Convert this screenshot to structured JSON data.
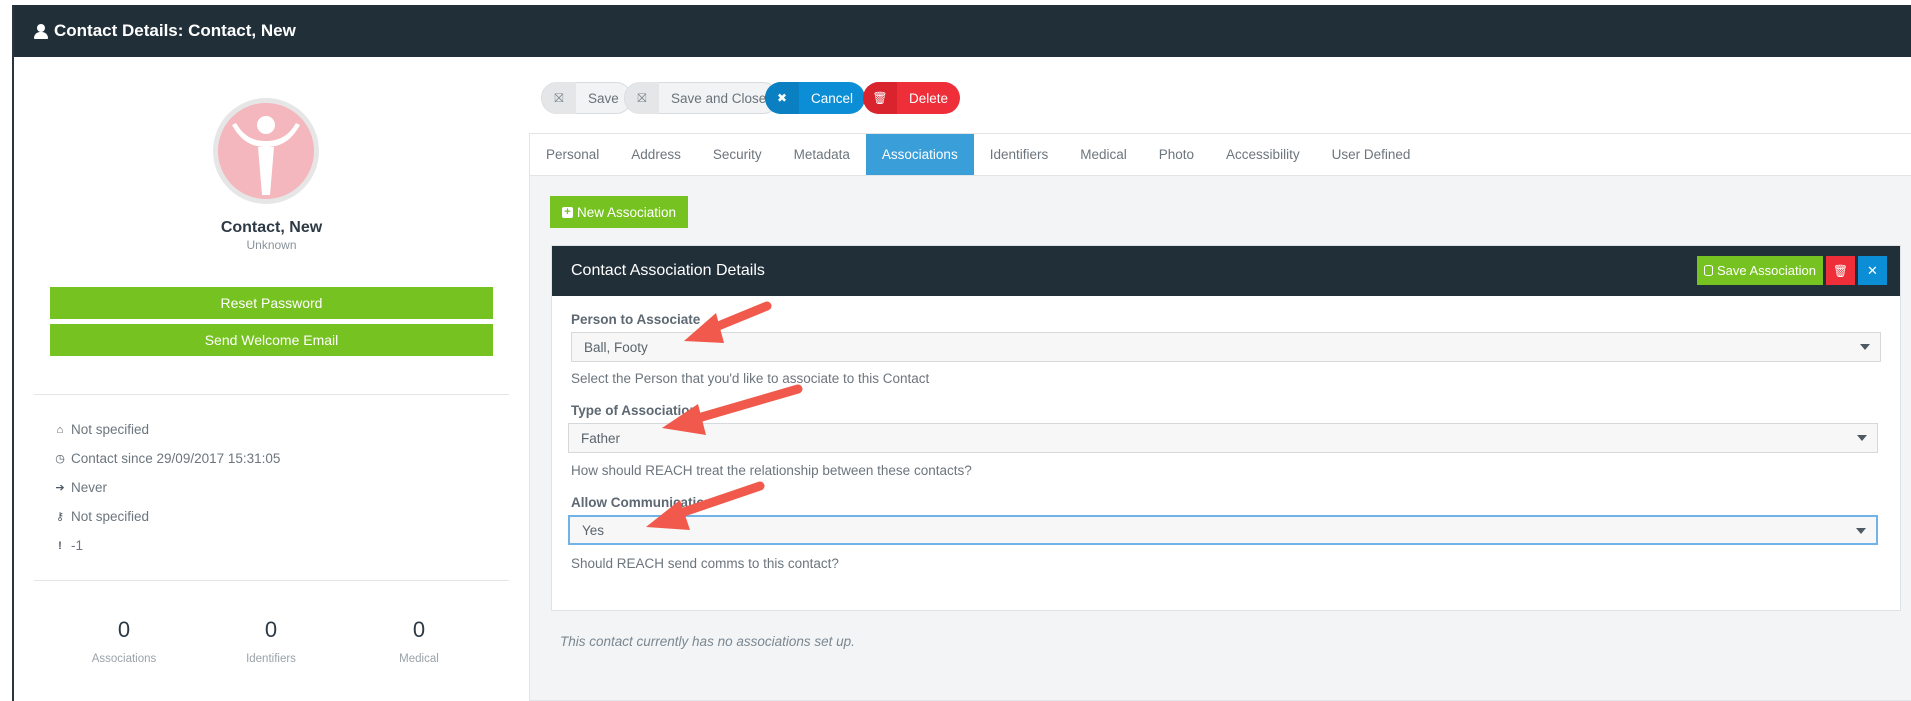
{
  "window": {
    "title": "Contact Details: Contact, New"
  },
  "profile": {
    "name": "Contact, New",
    "subtitle": "Unknown",
    "reset_password_label": "Reset Password",
    "send_welcome_label": "Send Welcome Email",
    "info": [
      {
        "icon": "home-icon",
        "text": "Not specified"
      },
      {
        "icon": "clock-icon",
        "text": "Contact since 29/09/2017 15:31:05"
      },
      {
        "icon": "sign-in-icon",
        "text": "Never"
      },
      {
        "icon": "key-icon",
        "text": "Not specified"
      },
      {
        "icon": "exclamation-icon",
        "text": "-1"
      }
    ],
    "stats": [
      {
        "value": "0",
        "label": "Associations"
      },
      {
        "value": "0",
        "label": "Identifiers"
      },
      {
        "value": "0",
        "label": "Medical"
      }
    ]
  },
  "toolbar": {
    "save_label": "Save",
    "save_close_label": "Save and Close",
    "cancel_label": "Cancel",
    "delete_label": "Delete"
  },
  "tabs": [
    "Personal",
    "Address",
    "Security",
    "Metadata",
    "Associations",
    "Identifiers",
    "Medical",
    "Photo",
    "Accessibility",
    "User Defined"
  ],
  "active_tab": "Associations",
  "associations": {
    "new_label": "New Association",
    "card_title": "Contact Association Details",
    "save_assoc_label": "Save Association",
    "person_label": "Person to Associate",
    "person_value": "Ball, Footy",
    "person_help": "Select the Person that you'd like to associate to this Contact",
    "type_label": "Type of Association",
    "type_value": "Father",
    "type_help": "How should REACH treat the relationship between these contacts?",
    "comms_label": "Allow Communication",
    "comms_value": "Yes",
    "comms_help": "Should REACH send comms to this contact?",
    "empty_text": "This contact currently has no associations set up."
  },
  "colors": {
    "header_bg": "#212f39",
    "green": "#76c221",
    "blue": "#0b8ed6",
    "red": "#ee2e38",
    "tab_active": "#3a9ed9",
    "arrow": "#f0594b"
  }
}
